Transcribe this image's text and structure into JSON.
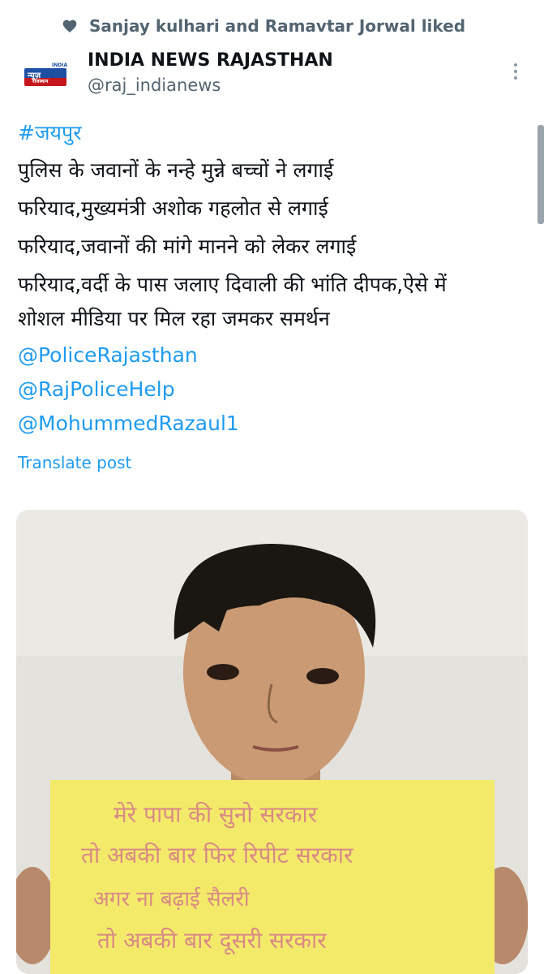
{
  "social_context": {
    "icon": "heart-icon",
    "text": "Sanjay kulhari and Ramavtar Jorwal liked"
  },
  "author": {
    "name": "INDIA NEWS RAJASTHAN",
    "handle": "@raj_indianews",
    "avatar_logo_top": "INDIA",
    "avatar_logo_mark": "न्यूज़",
    "avatar_logo_sub": "राजस्थान"
  },
  "post": {
    "hashtag": "#जयपुर",
    "lines": [
      "पुलिस के जवानों के नन्हे मुन्ने बच्चों ने लगाई",
      "फरियाद,मुख्यमंत्री अशोक गहलोत से लगाई",
      "फरियाद,जवानों की मांगे मानने को लेकर लगाई",
      "फरियाद,वर्दी के पास जलाए दिवाली की भांति दीपक,ऐसे में",
      "शोशल मीडिया पर मिल रहा जमकर समर्थन"
    ],
    "mentions": [
      "@PoliceRajasthan",
      "@RajPoliceHelp",
      "@MohummedRazaul1"
    ],
    "translate_label": "Translate post"
  },
  "media": {
    "placard_lines": [
      "मेरे पापा की सुनो सरकार",
      "तो अबकी बार फिर रिपीट सरकार",
      "अगर ना बढ़ाई सैलरी",
      "तो अबकी बार दूसरी सरकार"
    ]
  },
  "colors": {
    "accent": "#1d9bf0",
    "text": "#0f1419",
    "muted": "#536471",
    "placard": "#f4ea6a"
  }
}
